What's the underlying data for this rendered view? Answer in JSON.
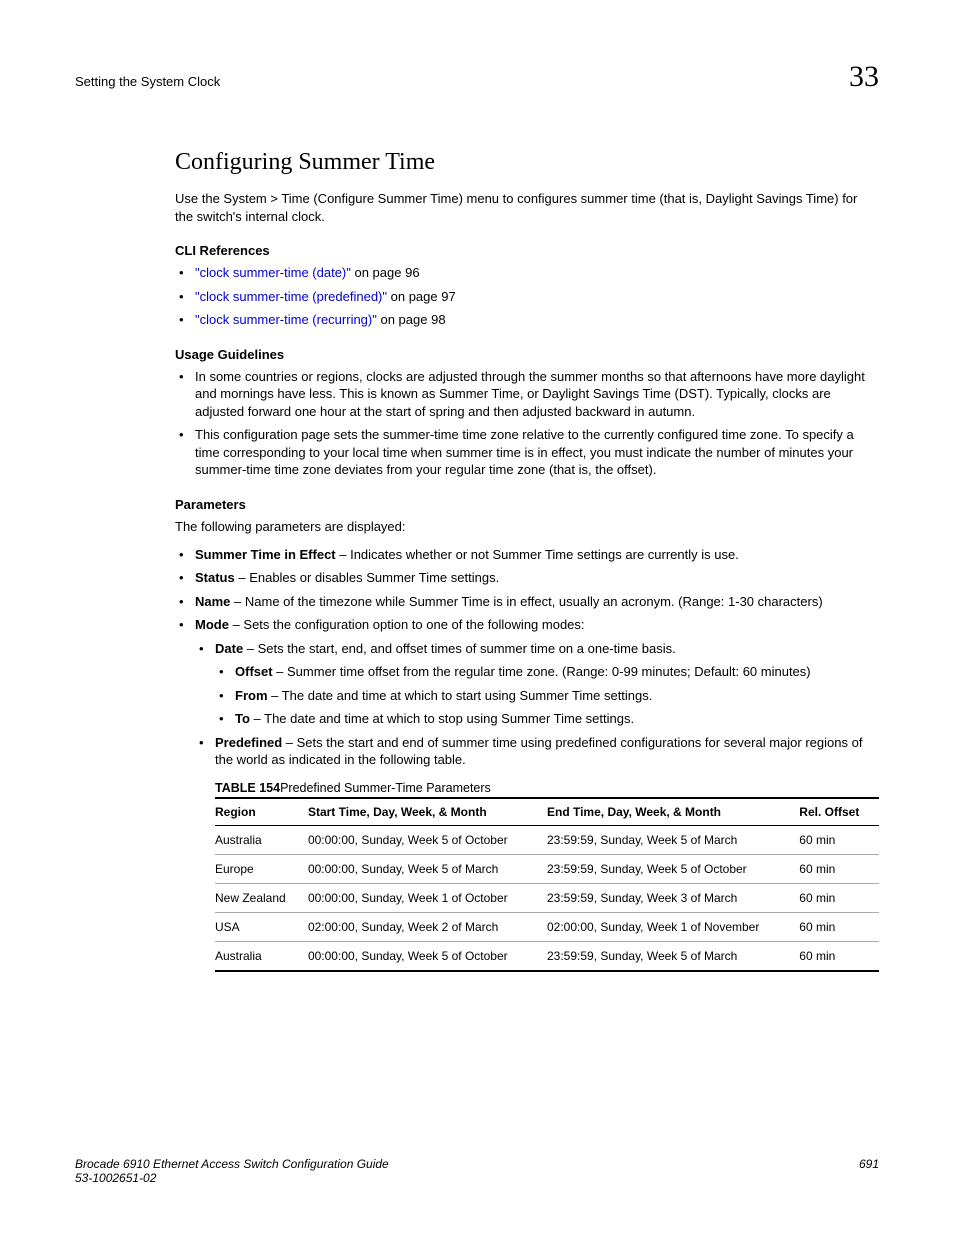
{
  "header": {
    "breadcrumb": "Setting the System Clock",
    "chapter_number": "33"
  },
  "section": {
    "title": "Configuring Summer Time",
    "intro": "Use the System > Time (Configure Summer Time) menu to configures summer time (that is, Daylight Savings Time) for the switch's internal clock."
  },
  "cli_refs": {
    "heading": "CLI References",
    "items": [
      {
        "link": "\"clock summer-time (date)\"",
        "suffix": " on page 96"
      },
      {
        "link": "\"clock summer-time (predefined)\"",
        "suffix": " on page 97"
      },
      {
        "link": "\"clock summer-time (recurring)\"",
        "suffix": " on page 98"
      }
    ]
  },
  "usage": {
    "heading": "Usage Guidelines",
    "items": [
      "In some countries or regions, clocks are adjusted through the summer months so that afternoons have more daylight and mornings have less. This is known as Summer Time, or Daylight Savings Time (DST). Typically, clocks are adjusted forward one hour at the start of spring and then adjusted backward in autumn.",
      "This configuration page sets the summer-time time zone relative to the currently configured time zone. To specify a time corresponding to your local time when summer time is in effect, you must indicate the number of minutes your summer-time time zone deviates from your regular time zone (that is, the offset)."
    ]
  },
  "params": {
    "heading": "Parameters",
    "intro": "The following parameters are displayed:",
    "summer_in_effect": {
      "label": "Summer Time in Effect",
      "text": " – Indicates whether or not Summer Time settings are currently is use."
    },
    "status": {
      "label": "Status",
      "text": " – Enables or disables Summer Time settings."
    },
    "name": {
      "label": "Name",
      "text": " – Name of the timezone while Summer Time is in effect, usually an acronym. (Range: 1-30 characters)"
    },
    "mode": {
      "label": "Mode",
      "text": " – Sets the configuration option to one of the following modes:",
      "date": {
        "label": "Date",
        "text": " – Sets the start, end, and offset times of summer time on a one-time basis.",
        "offset": {
          "label": "Offset",
          "text": " – Summer time offset from the regular time zone. (Range: 0-99 minutes; Default: 60 minutes)"
        },
        "from": {
          "label": "From",
          "text": " – The date and time at which to start using Summer Time settings."
        },
        "to": {
          "label": "To",
          "text": " – The date and time at which to stop using Summer Time settings."
        }
      },
      "predefined": {
        "label": "Predefined",
        "text": " – Sets the start and end of summer time using predefined configurations for several major regions of the world as indicated in the following table."
      }
    }
  },
  "table": {
    "label": "TABLE 154",
    "title": "Predefined Summer-Time Parameters",
    "headers": {
      "region": "Region",
      "start": "Start Time, Day,  Week, & Month",
      "end": "End Time, Day,  Week, & Month",
      "offset": "Rel. Offset"
    },
    "rows": [
      {
        "region": "Australia",
        "start": "00:00:00, Sunday, Week 5 of October",
        "end": "23:59:59, Sunday, Week 5 of March",
        "offset": "60 min"
      },
      {
        "region": "Europe",
        "start": "00:00:00, Sunday, Week 5 of March",
        "end": "23:59:59, Sunday, Week 5 of October",
        "offset": "60 min"
      },
      {
        "region": "New Zealand",
        "start": "00:00:00, Sunday, Week 1 of October",
        "end": "23:59:59, Sunday, Week 3 of March",
        "offset": "60 min"
      },
      {
        "region": "USA",
        "start": "02:00:00, Sunday, Week 2 of March",
        "end": "02:00:00, Sunday, Week 1 of November",
        "offset": "60 min"
      },
      {
        "region": "Australia",
        "start": "00:00:00, Sunday, Week 5 of October",
        "end": "23:59:59, Sunday, Week 5 of March",
        "offset": "60 min"
      }
    ]
  },
  "footer": {
    "line1": "Brocade 6910 Ethernet Access Switch Configuration Guide",
    "line2": "53-1002651-02",
    "page": "691"
  }
}
